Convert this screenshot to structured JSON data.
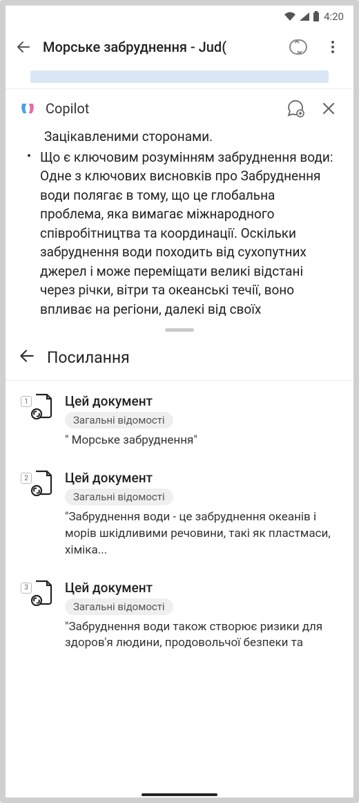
{
  "status": {
    "time": "4:20"
  },
  "header": {
    "title": "Морське забруднення - Jud("
  },
  "copilot": {
    "title": "Copilot",
    "line_prev": "Зацікавленими сторонами.",
    "bullet": "Що є ключовим розумінням забруднення води: Одне з ключових висновків про Забруднення води полягає в тому, що це глобальна проблема, яка вимагає міжнародного співробітництва та координації. Оскільки забруднення води походить від сухопутних джерел і може переміщати великі відстані через річки, вітри та океанські течії, воно впливає на регіони, далекі від своїх"
  },
  "refs": {
    "title": "Посилання",
    "items": [
      {
        "num": "1",
        "title": "Цей документ",
        "badge": "Загальні відомості",
        "quote": "\" Морське забруднення\""
      },
      {
        "num": "2",
        "title": "Цей документ",
        "badge": "Загальні відомості",
        "quote": "\"Забруднення води - це забруднення океанів і морів шкідливими речовини, такі як пластмаси, хіміка..."
      },
      {
        "num": "3",
        "title": "Цей документ",
        "badge": "Загальні відомості",
        "quote": "\"Забруднення води також створює ризики для здоров'я людини, продовольчої безпеки та"
      }
    ]
  }
}
